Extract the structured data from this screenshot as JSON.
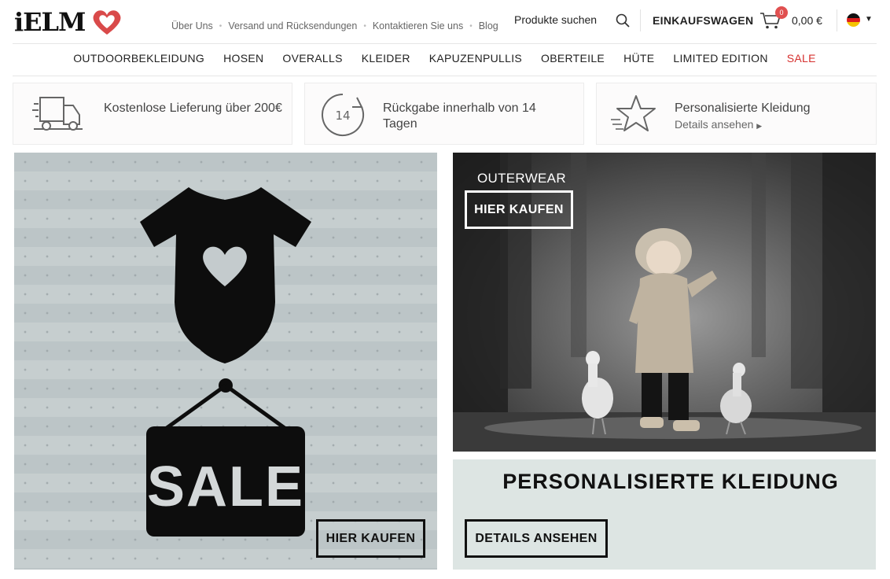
{
  "header": {
    "logo_text": "iELM",
    "top_links": [
      "Über Uns",
      "Versand und Rücksendungen",
      "Kontaktieren Sie uns",
      "Blog"
    ],
    "search_label": "Produkte suchen",
    "cart_label": "EINKAUFSWAGEN",
    "cart_count": "0",
    "cart_total": "0,00 €",
    "language_icon": "german-flag-icon"
  },
  "nav": {
    "items": [
      "OUTDOORBEKLEIDUNG",
      "HOSEN",
      "OVERALLS",
      "KLEIDER",
      "KAPUZENPULLIS",
      "OBERTEILE",
      "HÜTE",
      "LIMITED EDITION"
    ],
    "sale": "SALE",
    "sale_color": "#d6302e"
  },
  "features": {
    "delivery": "Kostenlose Lieferung über 200€",
    "returns_badge": "14",
    "returns": "Rückgabe innerhalb von 14 Tagen",
    "personalized": "Personalisierte Kleidung",
    "personalized_link": "Details ansehen"
  },
  "banners": {
    "sale_sign": "SALE",
    "sale_button": "HIER KAUFEN",
    "outerwear_label": "OUTERWEAR",
    "outerwear_button": "HIER KAUFEN",
    "personalized_title": "PERSONALISIERTE KLEIDUNG",
    "personalized_button": "DETAILS ANSEHEN"
  }
}
